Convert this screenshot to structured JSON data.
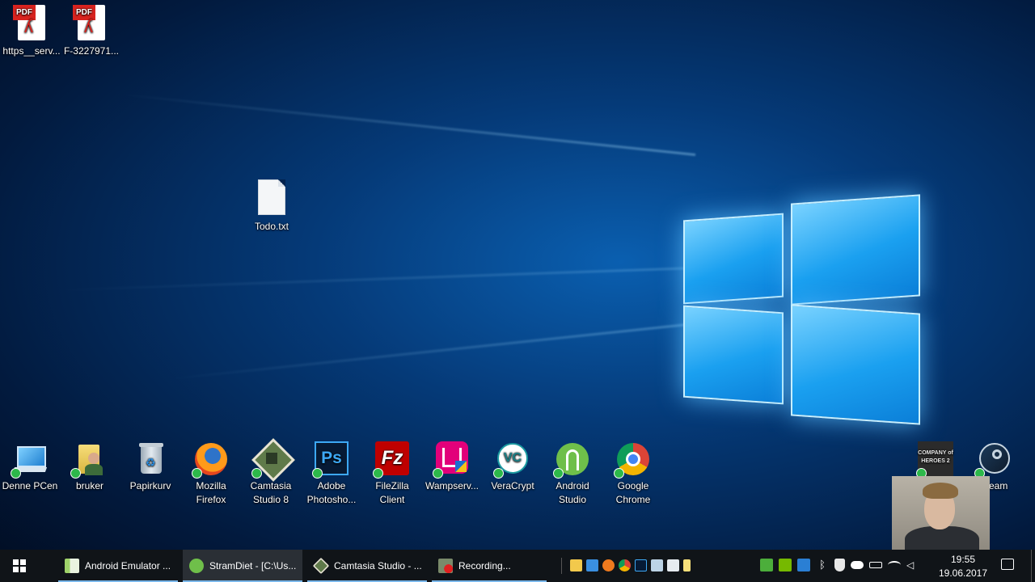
{
  "desktop": {
    "icons": [
      {
        "label": "https__serv...",
        "icon": "pdf-file-icon"
      },
      {
        "label": "F-3227971...",
        "icon": "pdf-file-icon"
      },
      {
        "label": "Todo.txt",
        "icon": "text-file-icon"
      },
      {
        "label": "Denne PCen",
        "icon": "computer-icon"
      },
      {
        "label": "bruker",
        "icon": "user-folder-icon"
      },
      {
        "label": "Papirkurv",
        "icon": "recycle-bin-icon"
      },
      {
        "label": "Mozilla Firefox",
        "icon": "firefox-icon"
      },
      {
        "label": "Camtasia Studio 8",
        "icon": "camtasia-icon"
      },
      {
        "label": "Adobe Photosho...",
        "icon": "photoshop-icon"
      },
      {
        "label": "FileZilla Client",
        "icon": "filezilla-icon"
      },
      {
        "label": "Wampserv...",
        "icon": "wampserver-icon"
      },
      {
        "label": "VeraCrypt",
        "icon": "veracrypt-icon"
      },
      {
        "label": "Android Studio",
        "icon": "android-studio-icon"
      },
      {
        "label": "Google Chrome",
        "icon": "chrome-icon"
      },
      {
        "label": "Steam",
        "icon": "steam-icon"
      }
    ],
    "pdf_tag": "PDF",
    "ps_text": "Ps",
    "fz_text": "Fz",
    "coh_text": "COMPANY of HEROES 2"
  },
  "taskbar": {
    "tasks": [
      {
        "label": "Android Emulator ...",
        "icon": "android-emulator-icon"
      },
      {
        "label": "StramDiet - [C:\\Us...",
        "icon": "android-studio-icon"
      },
      {
        "label": "Camtasia Studio - ...",
        "icon": "camtasia-icon"
      },
      {
        "label": "Recording...",
        "icon": "recording-icon"
      }
    ],
    "clock": {
      "time": "19:55",
      "date": "19.06.2017"
    }
  },
  "colors": {
    "accent": "#7ab7ea",
    "taskbar": "#101418",
    "pdf_red": "#d8231f"
  }
}
